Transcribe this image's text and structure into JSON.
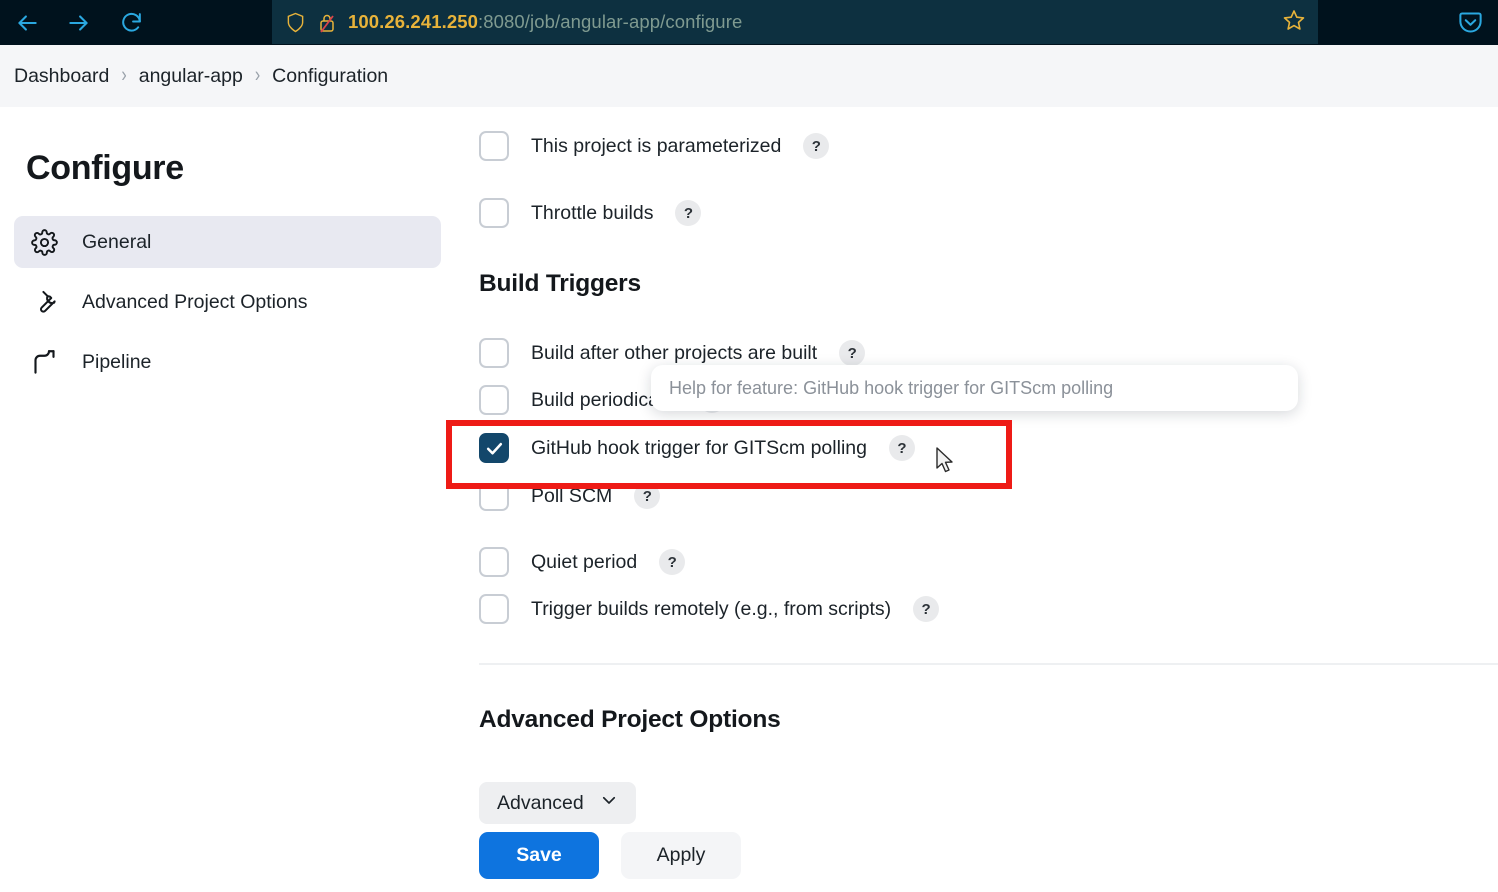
{
  "browser": {
    "back_icon": "arrow-left-icon",
    "forward_icon": "arrow-right-icon",
    "reload_icon": "reload-icon",
    "shield_icon": "shield-icon",
    "lock_broken_icon": "lock-broken-icon",
    "bookmark_icon": "star-icon",
    "pocket_icon": "pocket-icon",
    "url_host": "100.26.241.250",
    "url_rest": ":8080/job/angular-app/configure"
  },
  "breadcrumb": {
    "items": [
      {
        "label": "Dashboard"
      },
      {
        "label": "angular-app"
      },
      {
        "label": "Configuration"
      }
    ],
    "separator": "›"
  },
  "sidebar": {
    "title": "Configure",
    "items": [
      {
        "label": "General",
        "icon": "gear-icon",
        "active": true
      },
      {
        "label": "Advanced Project Options",
        "icon": "wrench-icon",
        "active": false
      },
      {
        "label": "Pipeline",
        "icon": "pipeline-icon",
        "active": false
      }
    ]
  },
  "main": {
    "top_options": [
      {
        "label": "This project is parameterized",
        "checked": false,
        "help": "?"
      },
      {
        "label": "Throttle builds",
        "checked": false,
        "help": "?"
      }
    ],
    "build_triggers": {
      "heading": "Build Triggers",
      "items": [
        {
          "label": "Build after other projects are built",
          "checked": false,
          "help": "?"
        },
        {
          "label": "Build periodically",
          "checked": false,
          "help": "?"
        },
        {
          "label": "GitHub hook trigger for GITScm polling",
          "checked": true,
          "help": "?"
        },
        {
          "label": "Poll SCM",
          "checked": false,
          "help": "?"
        },
        {
          "label": "Quiet period",
          "checked": false,
          "help": "?"
        },
        {
          "label": "Trigger builds remotely (e.g., from scripts)",
          "checked": false,
          "help": "?"
        }
      ]
    },
    "tooltip": {
      "text": "Help for feature: GitHub hook trigger for GITScm polling"
    },
    "advanced_section": {
      "heading": "Advanced Project Options",
      "dropdown_label": "Advanced",
      "dropdown_icon": "chevron-down-icon"
    },
    "actions": {
      "save_label": "Save",
      "apply_label": "Apply"
    }
  },
  "annotation": {
    "highlight_color": "#ee1b16",
    "cursor_icon": "mouse-pointer-icon"
  },
  "colors": {
    "accent_blue": "#0e74df",
    "checkbox_checked": "#13476b",
    "chrome_bg": "#00121d",
    "urlbar_bg": "#0d3040",
    "url_host_color": "#e8b33a",
    "breadcrumb_bg": "#f5f6f8",
    "sidebar_active_bg": "#e8e9f1"
  }
}
